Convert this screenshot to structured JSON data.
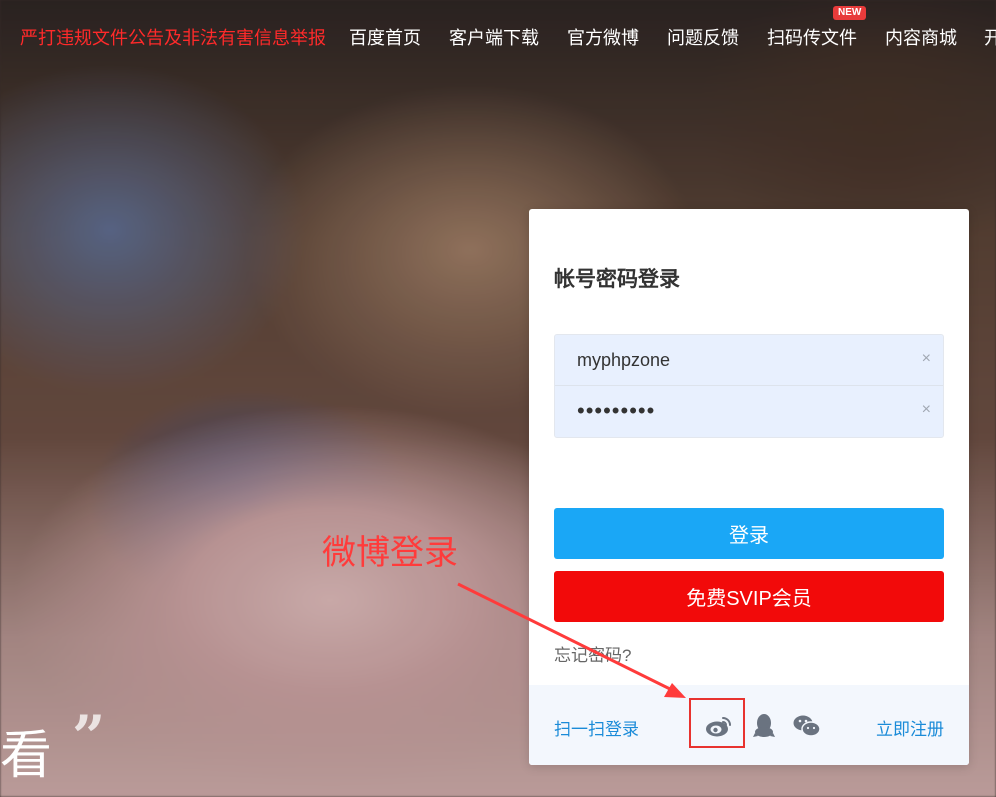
{
  "nav": {
    "report": "严打违规文件公告及非法有害信息举报",
    "home": "百度首页",
    "client_download": "客户端下载",
    "official_weibo": "官方微博",
    "feedback": "问题反馈",
    "scan_upload": "扫码传文件",
    "scan_upload_badge": "NEW",
    "content_mall": "内容商城",
    "more": "开"
  },
  "login": {
    "title": "帐号密码登录",
    "username": "myphpzone",
    "password": "•••••••••",
    "clear_icon": "×",
    "login_button": "登录",
    "svip_button": "免费SVIP会员",
    "forgot_password": "忘记密码?",
    "scan_login": "扫一扫登录",
    "register": "立即注册"
  },
  "social_icons": [
    "weibo-icon",
    "qq-icon",
    "wechat-icon"
  ],
  "annotation": {
    "label": "微博登录",
    "color": "#ff3b3b"
  },
  "background_text": {
    "char": "看",
    "quote": "”"
  },
  "colors": {
    "primary_blue": "#1aa7f6",
    "svip_red": "#f20a0a",
    "link_blue": "#1a8bd8",
    "report_red": "#ff2a2a"
  }
}
